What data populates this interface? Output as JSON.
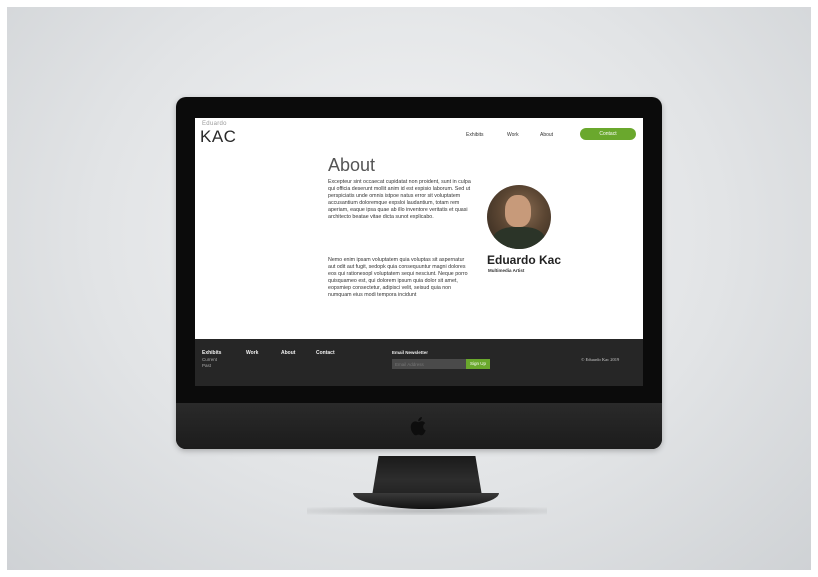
{
  "site": {
    "logo_small": "Eduardo",
    "logo_big": "KAC"
  },
  "nav": {
    "items": [
      {
        "label": "Exhibits"
      },
      {
        "label": "Work"
      },
      {
        "label": "About"
      }
    ],
    "contact_label": "Contact"
  },
  "about": {
    "title": "About",
    "paragraph1": "Excepteur sint occaecat cupidatat non proident, sunt in culpa qui officia deserunt mollit anim id est expisio laborum. Sed ut perspiciatis unde omnis istpoe natus error sit voluptatem accusantium doloremque expsloi laudantium, totam rem aperiam, eaque ipsa quae ab illo inventore veritatis et quasi architecto beatae vitae dicta sunot explicabo.",
    "paragraph2": "Nemo enim ipsam voluptatem quia voluptas sit aspernatur aut odit aut fugit, sedopk quia consequuntur magni dolores eos qui rationesopl voluptatem sequi nesciunt. Neque porro quisquameo est, qui dolorem ipsum quia dolor sit amet, eopsmiep consectetur, adipisci velit, seisud quia non numquam eius modi tempora incidunt"
  },
  "profile": {
    "name": "Eduardo Kac",
    "role": "Multimedia Artist"
  },
  "footer": {
    "exhibits": "Exhibits",
    "exhibits_sub1": "Current",
    "exhibits_sub2": "Past",
    "work": "Work",
    "about": "About",
    "contact": "Contact",
    "newsletter_label": "Email Newsletter",
    "email_placeholder": "Email Address",
    "signup_label": "Sign Up",
    "copyright": "© Eduardo Kac 2019"
  },
  "colors": {
    "accent": "#6aa82d",
    "footer_bg": "#262626"
  }
}
